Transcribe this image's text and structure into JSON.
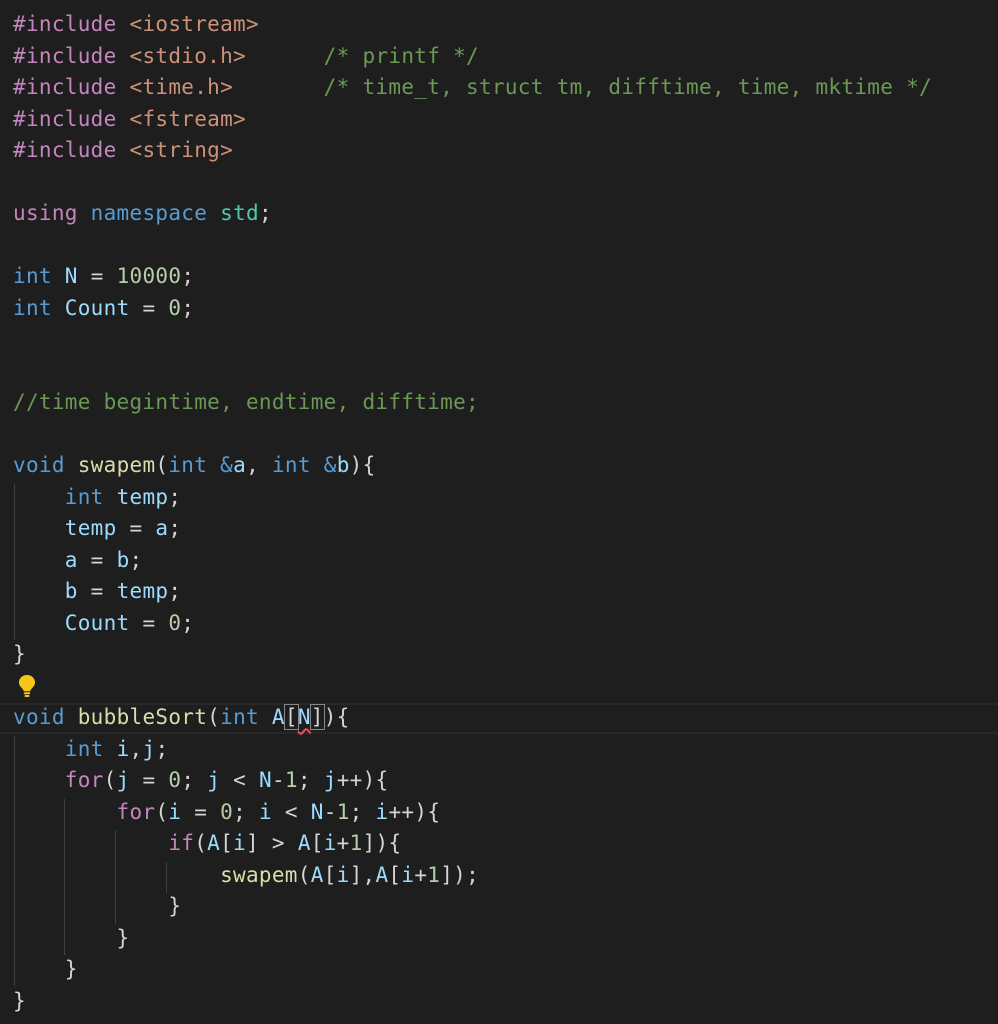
{
  "editor": {
    "lines": [
      [
        {
          "t": "#include",
          "c": "kw-pre"
        },
        {
          "t": " ",
          "c": "pl"
        },
        {
          "t": "<iostream>",
          "c": "str"
        }
      ],
      [
        {
          "t": "#include",
          "c": "kw-pre"
        },
        {
          "t": " ",
          "c": "pl"
        },
        {
          "t": "<stdio.h>",
          "c": "str"
        },
        {
          "t": "      ",
          "c": "pl"
        },
        {
          "t": "/* printf */",
          "c": "cm"
        }
      ],
      [
        {
          "t": "#include",
          "c": "kw-pre"
        },
        {
          "t": " ",
          "c": "pl"
        },
        {
          "t": "<time.h>",
          "c": "str"
        },
        {
          "t": "       ",
          "c": "pl"
        },
        {
          "t": "/* time_t, struct tm, difftime, time, mktime */",
          "c": "cm"
        }
      ],
      [
        {
          "t": "#include",
          "c": "kw-pre"
        },
        {
          "t": " ",
          "c": "pl"
        },
        {
          "t": "<fstream>",
          "c": "str"
        }
      ],
      [
        {
          "t": "#include",
          "c": "kw-pre"
        },
        {
          "t": " ",
          "c": "pl"
        },
        {
          "t": "<string>",
          "c": "str"
        }
      ],
      [],
      [
        {
          "t": "using",
          "c": "kw-pre"
        },
        {
          "t": " ",
          "c": "pl"
        },
        {
          "t": "namespace",
          "c": "kw"
        },
        {
          "t": " ",
          "c": "pl"
        },
        {
          "t": "std",
          "c": "ns"
        },
        {
          "t": ";",
          "c": "pl"
        }
      ],
      [],
      [
        {
          "t": "int",
          "c": "kw"
        },
        {
          "t": " ",
          "c": "pl"
        },
        {
          "t": "N",
          "c": "var"
        },
        {
          "t": " = ",
          "c": "pl"
        },
        {
          "t": "10000",
          "c": "num"
        },
        {
          "t": ";",
          "c": "pl"
        }
      ],
      [
        {
          "t": "int",
          "c": "kw"
        },
        {
          "t": " ",
          "c": "pl"
        },
        {
          "t": "Count",
          "c": "var"
        },
        {
          "t": " = ",
          "c": "pl"
        },
        {
          "t": "0",
          "c": "num"
        },
        {
          "t": ";",
          "c": "pl"
        }
      ],
      [],
      [],
      [
        {
          "t": "//time begintime, endtime, difftime;",
          "c": "cm"
        }
      ],
      [],
      [
        {
          "t": "void",
          "c": "kw"
        },
        {
          "t": " ",
          "c": "pl"
        },
        {
          "t": "swapem",
          "c": "fn"
        },
        {
          "t": "(",
          "c": "pl"
        },
        {
          "t": "int",
          "c": "kw"
        },
        {
          "t": " ",
          "c": "pl"
        },
        {
          "t": "&",
          "c": "kw"
        },
        {
          "t": "a",
          "c": "var"
        },
        {
          "t": ", ",
          "c": "pl"
        },
        {
          "t": "int",
          "c": "kw"
        },
        {
          "t": " ",
          "c": "pl"
        },
        {
          "t": "&",
          "c": "kw"
        },
        {
          "t": "b",
          "c": "var"
        },
        {
          "t": "){",
          "c": "pl"
        }
      ],
      [
        {
          "t": "    ",
          "c": "pl"
        },
        {
          "t": "int",
          "c": "kw"
        },
        {
          "t": " ",
          "c": "pl"
        },
        {
          "t": "temp",
          "c": "var"
        },
        {
          "t": ";",
          "c": "pl"
        }
      ],
      [
        {
          "t": "    ",
          "c": "pl"
        },
        {
          "t": "temp",
          "c": "var"
        },
        {
          "t": " = ",
          "c": "pl"
        },
        {
          "t": "a",
          "c": "var"
        },
        {
          "t": ";",
          "c": "pl"
        }
      ],
      [
        {
          "t": "    ",
          "c": "pl"
        },
        {
          "t": "a",
          "c": "var"
        },
        {
          "t": " = ",
          "c": "pl"
        },
        {
          "t": "b",
          "c": "var"
        },
        {
          "t": ";",
          "c": "pl"
        }
      ],
      [
        {
          "t": "    ",
          "c": "pl"
        },
        {
          "t": "b",
          "c": "var"
        },
        {
          "t": " = ",
          "c": "pl"
        },
        {
          "t": "temp",
          "c": "var"
        },
        {
          "t": ";",
          "c": "pl"
        }
      ],
      [
        {
          "t": "    ",
          "c": "pl"
        },
        {
          "t": "Count",
          "c": "var"
        },
        {
          "t": " = ",
          "c": "pl"
        },
        {
          "t": "0",
          "c": "num"
        },
        {
          "t": ";",
          "c": "pl"
        }
      ],
      [
        {
          "t": "}",
          "c": "pl"
        }
      ],
      [],
      [
        {
          "t": "void",
          "c": "kw"
        },
        {
          "t": " ",
          "c": "pl"
        },
        {
          "t": "bubbleSort",
          "c": "fn"
        },
        {
          "t": "(",
          "c": "pl"
        },
        {
          "t": "int",
          "c": "kw"
        },
        {
          "t": " ",
          "c": "pl"
        },
        {
          "t": "A",
          "c": "var"
        },
        {
          "t": "[",
          "c": "pl bracket-hl"
        },
        {
          "t": "N",
          "c": "var squiggle"
        },
        {
          "t": "]",
          "c": "pl bracket-hl"
        },
        {
          "t": "){",
          "c": "pl"
        }
      ],
      [
        {
          "t": "    ",
          "c": "pl"
        },
        {
          "t": "int",
          "c": "kw"
        },
        {
          "t": " ",
          "c": "pl"
        },
        {
          "t": "i",
          "c": "var"
        },
        {
          "t": ",",
          "c": "pl"
        },
        {
          "t": "j",
          "c": "var"
        },
        {
          "t": ";",
          "c": "pl"
        }
      ],
      [
        {
          "t": "    ",
          "c": "pl"
        },
        {
          "t": "for",
          "c": "ctrl"
        },
        {
          "t": "(",
          "c": "pl"
        },
        {
          "t": "j",
          "c": "var"
        },
        {
          "t": " = ",
          "c": "pl"
        },
        {
          "t": "0",
          "c": "num"
        },
        {
          "t": "; ",
          "c": "pl"
        },
        {
          "t": "j",
          "c": "var"
        },
        {
          "t": " < ",
          "c": "pl"
        },
        {
          "t": "N",
          "c": "var"
        },
        {
          "t": "-",
          "c": "pl"
        },
        {
          "t": "1",
          "c": "num"
        },
        {
          "t": "; ",
          "c": "pl"
        },
        {
          "t": "j",
          "c": "var"
        },
        {
          "t": "++){",
          "c": "pl"
        }
      ],
      [
        {
          "t": "        ",
          "c": "pl"
        },
        {
          "t": "for",
          "c": "ctrl"
        },
        {
          "t": "(",
          "c": "pl"
        },
        {
          "t": "i",
          "c": "var"
        },
        {
          "t": " = ",
          "c": "pl"
        },
        {
          "t": "0",
          "c": "num"
        },
        {
          "t": "; ",
          "c": "pl"
        },
        {
          "t": "i",
          "c": "var"
        },
        {
          "t": " < ",
          "c": "pl"
        },
        {
          "t": "N",
          "c": "var"
        },
        {
          "t": "-",
          "c": "pl"
        },
        {
          "t": "1",
          "c": "num"
        },
        {
          "t": "; ",
          "c": "pl"
        },
        {
          "t": "i",
          "c": "var"
        },
        {
          "t": "++){",
          "c": "pl"
        }
      ],
      [
        {
          "t": "            ",
          "c": "pl"
        },
        {
          "t": "if",
          "c": "ctrl"
        },
        {
          "t": "(",
          "c": "pl"
        },
        {
          "t": "A",
          "c": "var"
        },
        {
          "t": "[",
          "c": "pl"
        },
        {
          "t": "i",
          "c": "var"
        },
        {
          "t": "] > ",
          "c": "pl"
        },
        {
          "t": "A",
          "c": "var"
        },
        {
          "t": "[",
          "c": "pl"
        },
        {
          "t": "i",
          "c": "var"
        },
        {
          "t": "+",
          "c": "pl"
        },
        {
          "t": "1",
          "c": "num"
        },
        {
          "t": "]){",
          "c": "pl"
        }
      ],
      [
        {
          "t": "                ",
          "c": "pl"
        },
        {
          "t": "swapem",
          "c": "fn"
        },
        {
          "t": "(",
          "c": "pl"
        },
        {
          "t": "A",
          "c": "var"
        },
        {
          "t": "[",
          "c": "pl"
        },
        {
          "t": "i",
          "c": "var"
        },
        {
          "t": "],",
          "c": "pl"
        },
        {
          "t": "A",
          "c": "var"
        },
        {
          "t": "[",
          "c": "pl"
        },
        {
          "t": "i",
          "c": "var"
        },
        {
          "t": "+",
          "c": "pl"
        },
        {
          "t": "1",
          "c": "num"
        },
        {
          "t": "]);",
          "c": "pl"
        }
      ],
      [
        {
          "t": "            }",
          "c": "pl"
        }
      ],
      [
        {
          "t": "        }",
          "c": "pl"
        }
      ],
      [
        {
          "t": "    }",
          "c": "pl"
        }
      ],
      [
        {
          "t": "}",
          "c": "pl"
        }
      ]
    ]
  },
  "lightbulb": {
    "icon": "lightbulb-icon",
    "color": "#f5c518"
  }
}
